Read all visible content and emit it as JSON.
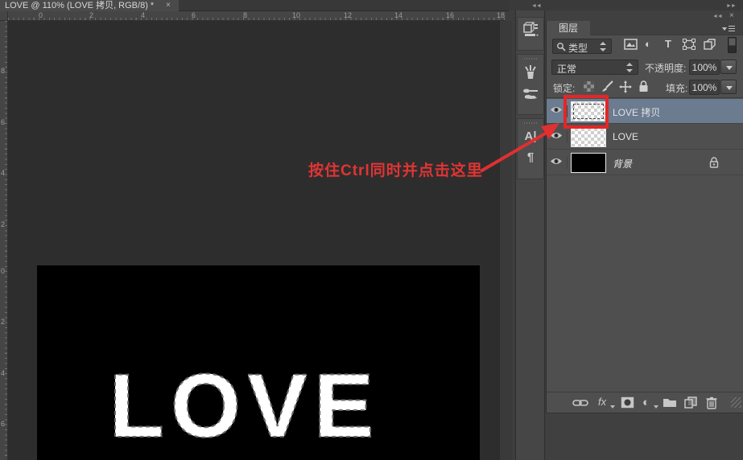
{
  "doc_tab": {
    "title": "LOVE @ 110% (LOVE 拷贝, RGB/8) *",
    "close_icon": "×"
  },
  "rulers": {
    "top": [
      "0",
      "2",
      "4",
      "6",
      "8",
      "10",
      "12",
      "14",
      "16",
      "18"
    ],
    "left": [
      "8",
      "6",
      "4",
      "2",
      "0",
      "2",
      "4",
      "6"
    ]
  },
  "canvas": {
    "word": "LOVE"
  },
  "annotation": {
    "note": "按住Ctrl同时并点击这里"
  },
  "dock": {
    "collapse_right": "►►",
    "collapse_left": "◄◄",
    "panel_close": "×"
  },
  "tool_strip": {
    "character_icon": "A|",
    "paragraph_icon": "¶"
  },
  "layers_panel": {
    "tab_label": "图层",
    "kind_label": "类型",
    "type_filter_icon": "T",
    "adjust_filter_icon": "◐",
    "blend_mode": "正常",
    "opacity_label": "不透明度:",
    "opacity_value": "100%",
    "lock_label": "锁定:",
    "fill_label": "填充:",
    "fill_value": "100%",
    "layers": [
      {
        "name": "LOVE 拷贝",
        "selected": true
      },
      {
        "name": "LOVE",
        "selected": false
      },
      {
        "name": "背景",
        "selected": false,
        "locked": true
      }
    ],
    "fx_label": "fx",
    "adjustment_icon": "◐"
  },
  "colors": {
    "selected_layer": "#6b7b90",
    "annotation_red": "#e03434",
    "canvas_black": "#000000",
    "panel_bg": "#4f4f4f"
  },
  "zoom_level": "110%"
}
